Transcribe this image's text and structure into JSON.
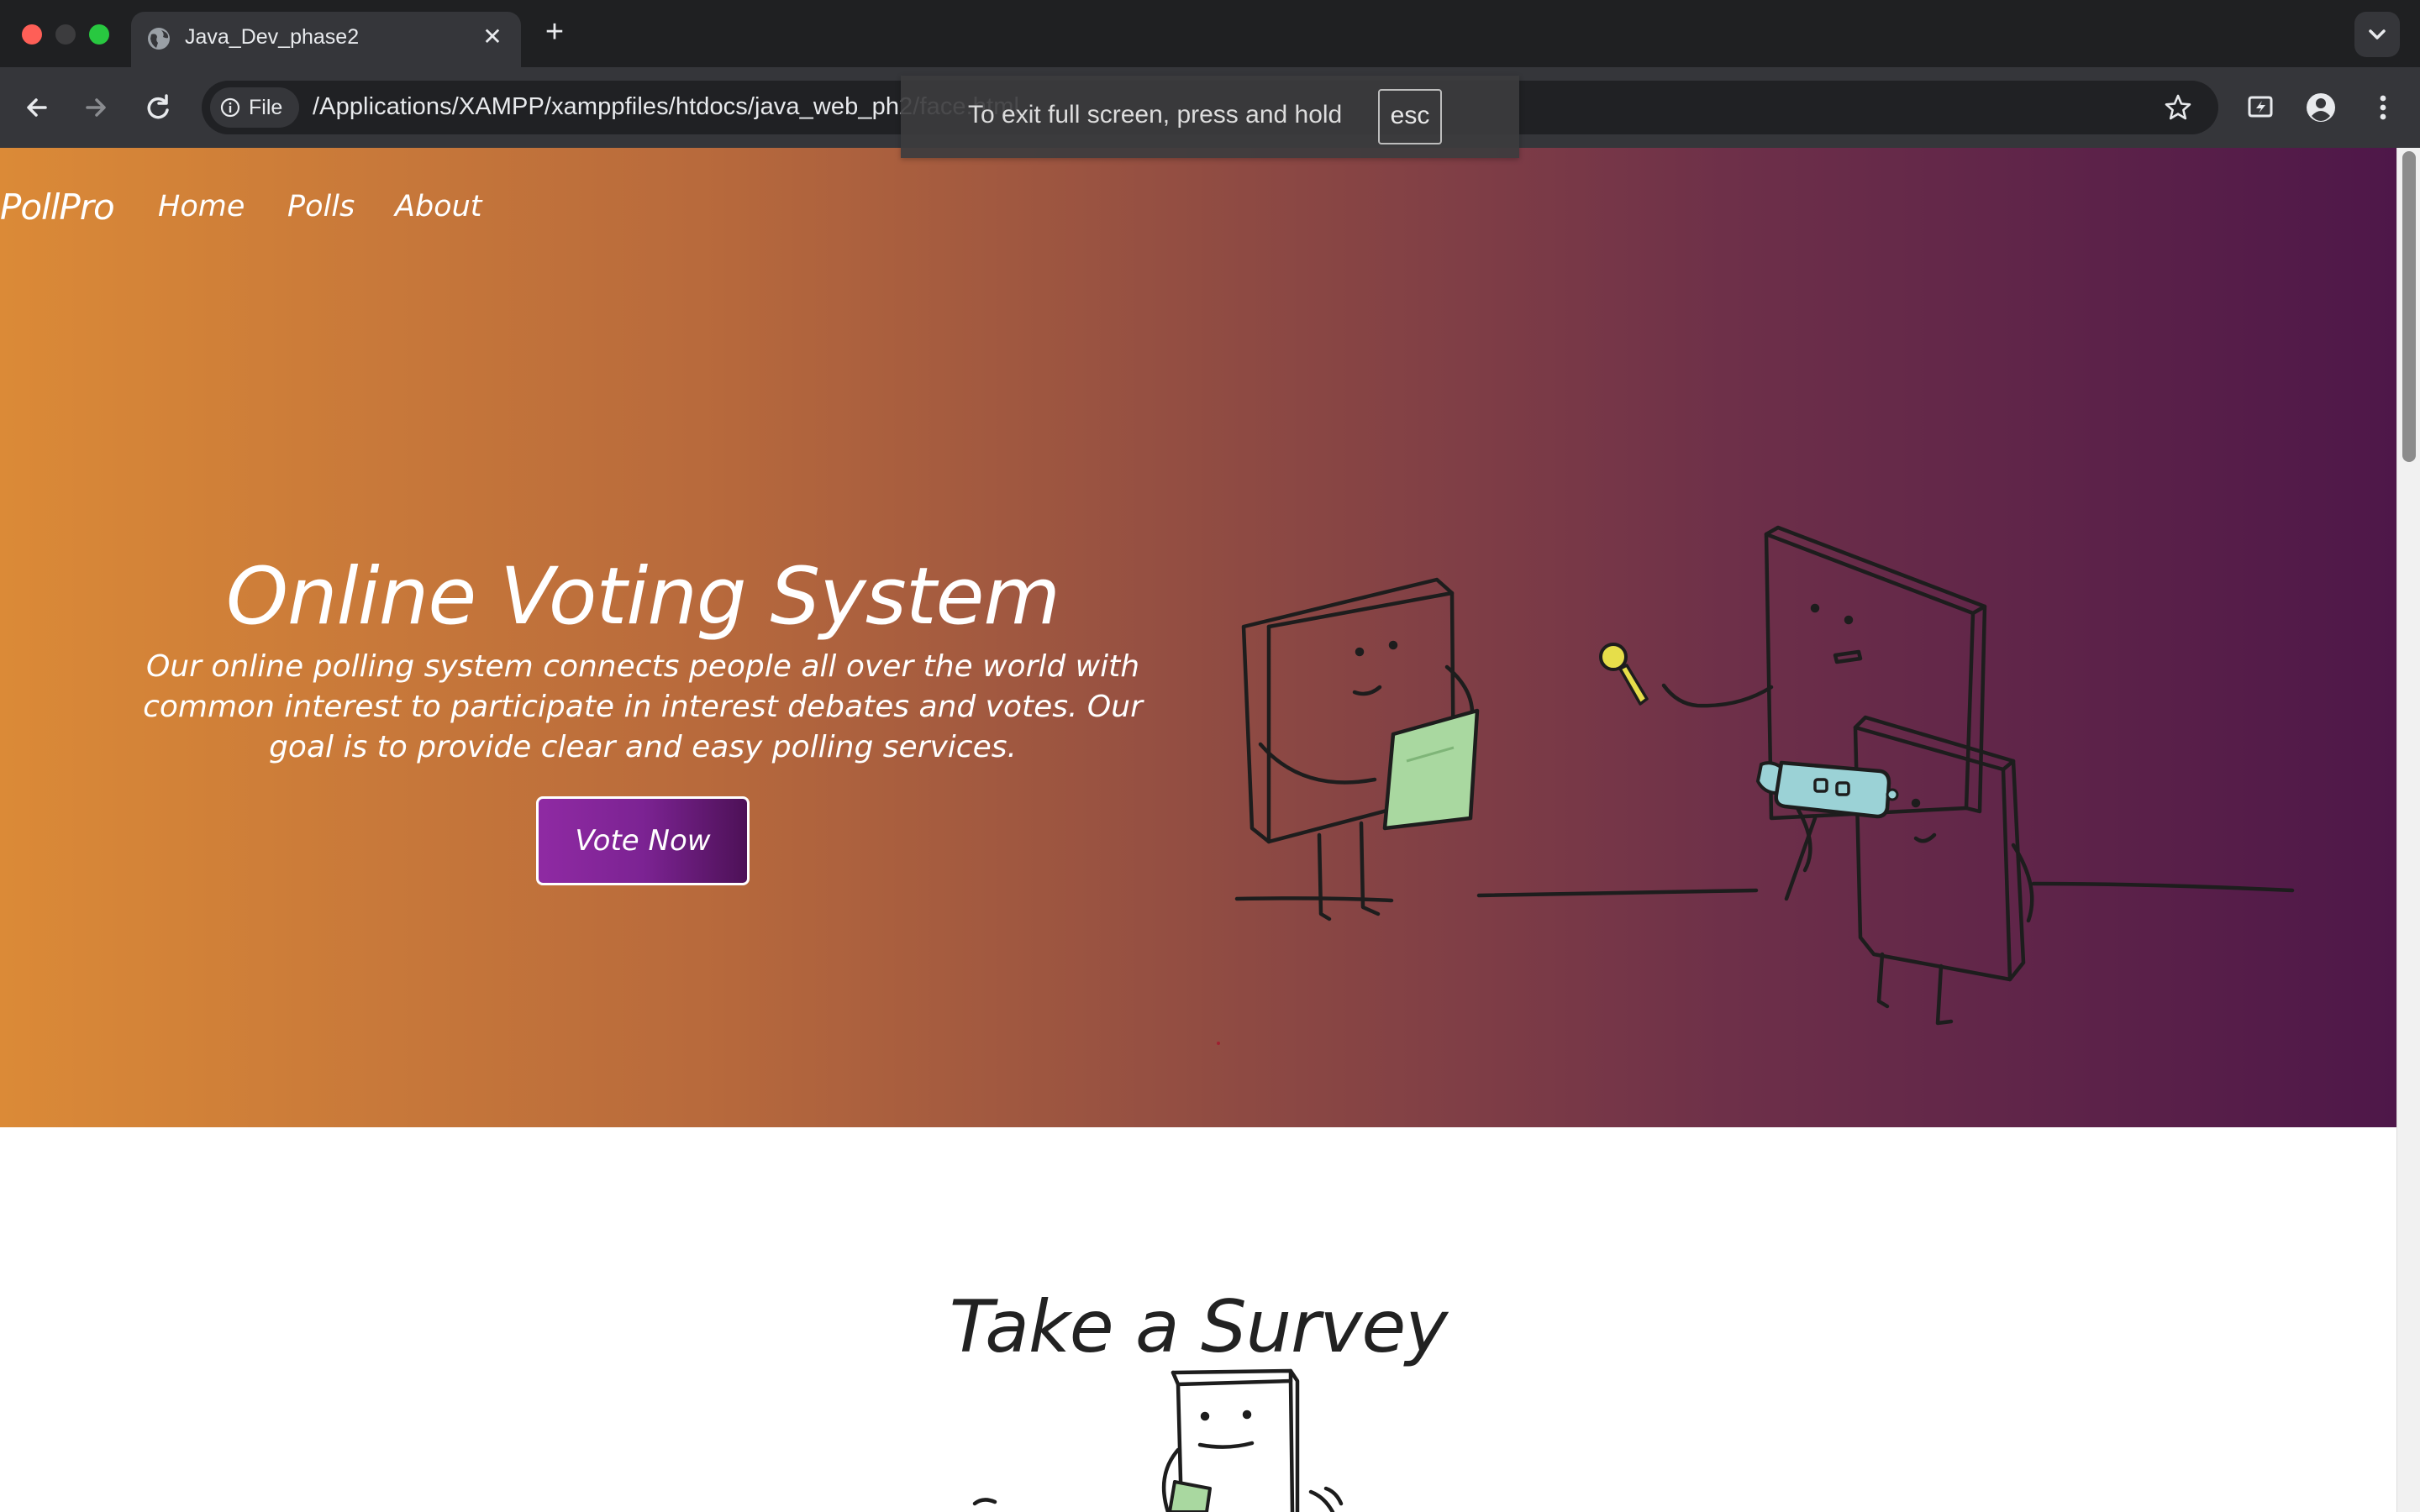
{
  "browser": {
    "tab_title": "Java_Dev_phase2",
    "tab_close": "✕",
    "new_tab": "+",
    "site_chip_label": "File",
    "url": "/Applications/XAMPP/xamppfiles/htdocs/java_web_ph2/face.html",
    "fullscreen_notice": "To exit full screen, press and hold",
    "fullscreen_key": "esc"
  },
  "nav": {
    "brand": "PollPro",
    "links": [
      "Home",
      "Polls",
      "About"
    ]
  },
  "hero": {
    "title": "Online Voting System",
    "description": "Our online polling system connects people all over the world with common interest to participate in interest debates and votes. Our goal is to provide clear and easy polling services.",
    "button_label": "Vote Now",
    "illustration": "interview-characters-illustration",
    "gradient_colors": [
      "#db8a37",
      "#8e4a43",
      "#4e1749"
    ]
  },
  "survey": {
    "title": "Take a Survey",
    "illustration": "survey-character-illustration"
  },
  "colors": {
    "button_gradient": [
      "#8f2aa3",
      "#4d1157"
    ],
    "chrome_dark": "#35363a"
  }
}
